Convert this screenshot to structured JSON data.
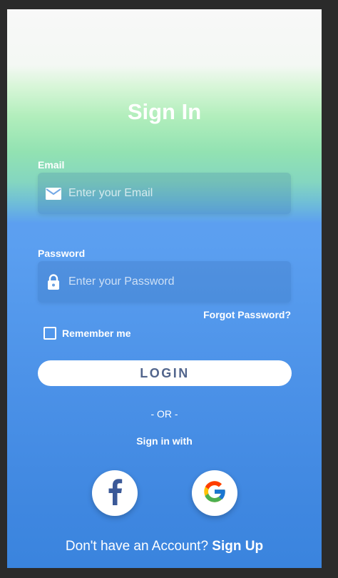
{
  "page": {
    "title": "Sign In"
  },
  "form": {
    "email_label": "Email",
    "email_placeholder": "Enter your Email",
    "email_value": "",
    "password_label": "Password",
    "password_placeholder": "Enter your Password",
    "password_value": "",
    "forgot_password": "Forgot Password?",
    "remember_me": "Remember me",
    "remember_checked": false,
    "login_button": "LOGIN"
  },
  "social": {
    "divider": "- OR -",
    "heading": "Sign in with",
    "providers": [
      {
        "name": "facebook",
        "icon": "facebook-icon",
        "color": "#3b5998"
      },
      {
        "name": "google",
        "icon": "google-icon"
      }
    ]
  },
  "footer": {
    "prompt": "Don't have an Account?",
    "signup_link": "Sign Up"
  },
  "colors": {
    "gradient_top": "#f8f8f8",
    "gradient_green": "#92e2b2",
    "gradient_blue": "#5b9ff0",
    "gradient_bottom": "#3a84de",
    "login_text": "#52658c"
  }
}
